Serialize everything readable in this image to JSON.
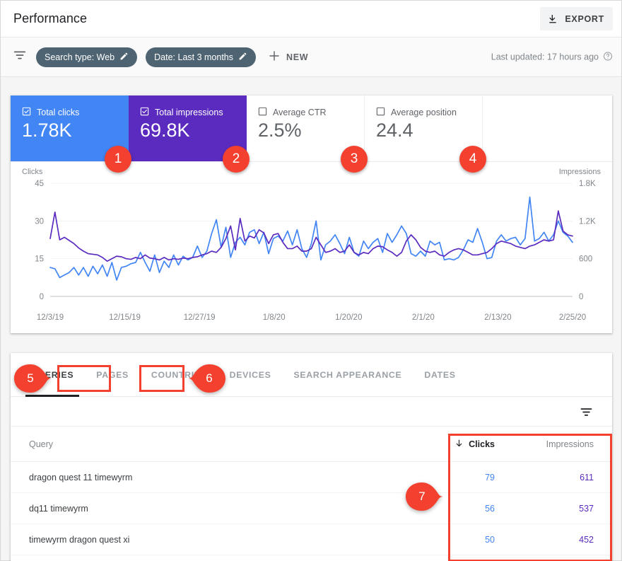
{
  "header": {
    "title": "Performance",
    "export_label": "EXPORT",
    "export_icon": "download-icon"
  },
  "filter_bar": {
    "funnel_icon": "filter-funnel-icon",
    "chips": [
      {
        "label": "Search type: Web",
        "edit_icon": "pencil-icon"
      },
      {
        "label": "Date: Last 3 months",
        "edit_icon": "pencil-icon"
      }
    ],
    "new_label": "NEW",
    "new_icon": "plus-icon",
    "last_updated": "Last updated: 17 hours ago",
    "help_icon": "question-mark-circle-icon"
  },
  "metrics": [
    {
      "label": "Total clicks",
      "value": "1.78K",
      "checked": true,
      "color": "#4285f4"
    },
    {
      "label": "Total impressions",
      "value": "69.8K",
      "checked": true,
      "color": "#5b2bbf"
    },
    {
      "label": "Average CTR",
      "value": "2.5%",
      "checked": false,
      "color": "#5f6368"
    },
    {
      "label": "Average position",
      "value": "24.4",
      "checked": false,
      "color": "#5f6368"
    }
  ],
  "chart_data": {
    "type": "line",
    "title": "",
    "xlabel": "",
    "ylabel": "Clicks",
    "y2label": "Impressions",
    "grid": true,
    "legend": "none",
    "axis_left": {
      "label": "Clicks",
      "ticks": [
        "0",
        "15",
        "30",
        "45"
      ],
      "ylim": [
        0,
        45
      ]
    },
    "axis_right": {
      "label": "Impressions",
      "ticks": [
        "0",
        "600",
        "1.2K",
        "1.8K"
      ],
      "ylim": [
        0,
        1800
      ]
    },
    "x_ticks": [
      "12/3/19",
      "12/15/19",
      "12/27/19",
      "1/8/20",
      "1/20/20",
      "2/1/20",
      "2/13/20",
      "2/25/20"
    ],
    "series": [
      {
        "name": "Total clicks",
        "color": "#4285f4",
        "axis": "left",
        "values": [
          11.5,
          11.0,
          7.5,
          8.5,
          9.5,
          11.5,
          8.5,
          11.5,
          8.0,
          12.0,
          9.0,
          12.5,
          8.0,
          13.5,
          6.5,
          11.5,
          12.0,
          13.0,
          13.5,
          17.5,
          13.5,
          10.0,
          16.5,
          9.5,
          14.0,
          11.5,
          16.5,
          12.5,
          16.0,
          14.5,
          15.5,
          20.0,
          15.5,
          18.0,
          25.0,
          30.5,
          19.5,
          27.5,
          15.5,
          21.5,
          23.5,
          20.5,
          25.5,
          26.5,
          21.0,
          25.5,
          17.0,
          23.0,
          24.0,
          22.0,
          26.0,
          20.5,
          26.5,
          19.0,
          15.5,
          21.0,
          30.0,
          14.5,
          20.5,
          22.0,
          24.5,
          21.0,
          17.0,
          23.5,
          17.5,
          16.0,
          22.0,
          19.0,
          21.5,
          23.0,
          17.5,
          25.0,
          21.5,
          24.5,
          28.0,
          25.0,
          17.0,
          16.0,
          18.0,
          16.0,
          22.0,
          20.5,
          21.5,
          14.5,
          15.0,
          14.5,
          15.5,
          18.5,
          22.5,
          21.5,
          27.0,
          21.5,
          15.0,
          15.5,
          22.0,
          24.5,
          22.0,
          23.0,
          23.5,
          20.5,
          23.0,
          39.5,
          22.0,
          23.0,
          25.5,
          22.0,
          24.5,
          30.0,
          25.5,
          24.0,
          21.5
        ]
      },
      {
        "name": "Total impressions",
        "color": "#5b2bbf",
        "axis": "right",
        "values": [
          920,
          1340,
          900,
          940,
          890,
          840,
          770,
          720,
          680,
          670,
          660,
          620,
          560,
          600,
          640,
          630,
          600,
          590,
          620,
          600,
          660,
          610,
          600,
          580,
          620,
          580,
          600,
          590,
          610,
          600,
          620,
          630,
          660,
          680,
          720,
          700,
          780,
          920,
          1120,
          740,
          1240,
          880,
          960,
          930,
          1060,
          1010,
          840,
          980,
          1000,
          860,
          760,
          760,
          800,
          720,
          720,
          760,
          940,
          820,
          700,
          720,
          760,
          700,
          720,
          820,
          700,
          660,
          700,
          680,
          760,
          800,
          790,
          740,
          700,
          640,
          700,
          880,
          980,
          900,
          780,
          720,
          700,
          720,
          660,
          640,
          700,
          740,
          760,
          740,
          700,
          660,
          660,
          680,
          700,
          760,
          840,
          880,
          860,
          840,
          800,
          780,
          760,
          800,
          820,
          860,
          900,
          880,
          900,
          1360,
          1040,
          980,
          960
        ]
      }
    ]
  },
  "table": {
    "tabs": [
      {
        "label": "QUERIES",
        "active": true
      },
      {
        "label": "PAGES",
        "active": false
      },
      {
        "label": "COUNTRIES",
        "active": false
      },
      {
        "label": "DEVICES",
        "active": false
      },
      {
        "label": "SEARCH APPEARANCE",
        "active": false
      },
      {
        "label": "DATES",
        "active": false
      }
    ],
    "filter_icon": "filter-funnel-icon",
    "columns": {
      "query": "Query",
      "clicks": "Clicks",
      "impressions": "Impressions",
      "sort_icon": "arrow-down-icon"
    },
    "rows": [
      {
        "query": "dragon quest 11 timewyrm",
        "clicks": "79",
        "impressions": "611"
      },
      {
        "query": "dq11 timewyrm",
        "clicks": "56",
        "impressions": "537"
      },
      {
        "query": "timewyrm dragon quest xi",
        "clicks": "50",
        "impressions": "452"
      }
    ]
  },
  "annotations": {
    "accent_color": "#f4402e",
    "circles": [
      {
        "num": "1"
      },
      {
        "num": "2"
      },
      {
        "num": "3"
      },
      {
        "num": "4"
      }
    ],
    "pins": [
      {
        "num": "5"
      },
      {
        "num": "6"
      },
      {
        "num": "7"
      }
    ]
  }
}
